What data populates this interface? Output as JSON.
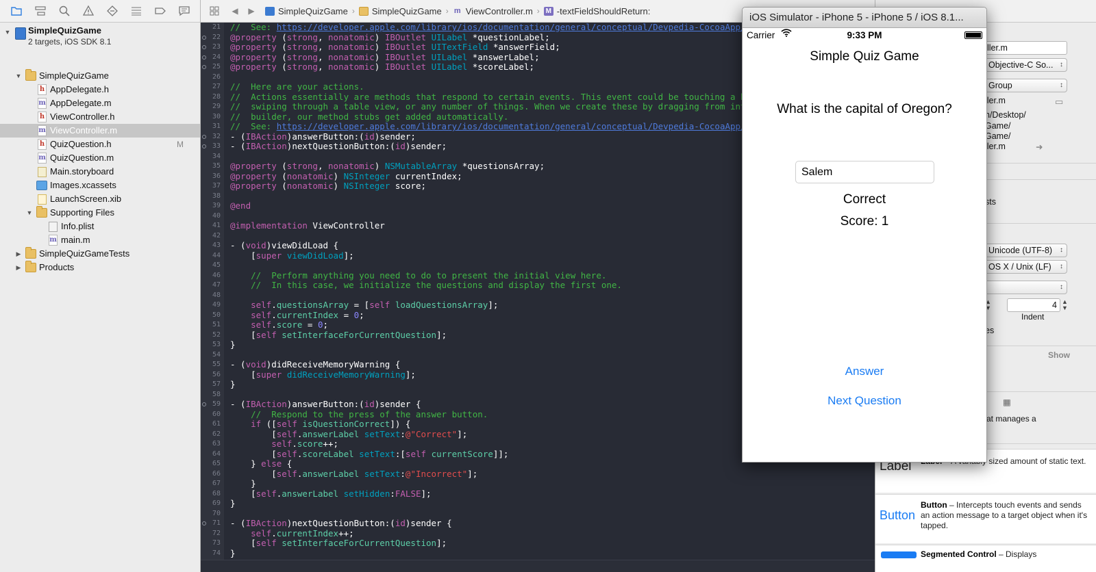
{
  "navigator": {
    "toolbar_icons": [
      "folder-icon",
      "hierarchy-icon",
      "search-icon",
      "warning-icon",
      "test-icon",
      "debug-icon",
      "breakpoint-icon",
      "log-icon"
    ],
    "project_name": "SimpleQuizGame",
    "project_subtitle": "2 targets, iOS SDK 8.1",
    "items": [
      {
        "label": "SimpleQuizGame",
        "kind": "folder",
        "badge": ""
      },
      {
        "label": "AppDelegate.h",
        "kind": "h",
        "badge": ""
      },
      {
        "label": "AppDelegate.m",
        "kind": "m",
        "badge": ""
      },
      {
        "label": "ViewController.h",
        "kind": "h",
        "badge": ""
      },
      {
        "label": "ViewController.m",
        "kind": "m",
        "badge": ""
      },
      {
        "label": "QuizQuestion.h",
        "kind": "h",
        "badge": "M"
      },
      {
        "label": "QuizQuestion.m",
        "kind": "m",
        "badge": ""
      },
      {
        "label": "Main.storyboard",
        "kind": "storyboard",
        "badge": ""
      },
      {
        "label": "Images.xcassets",
        "kind": "xcassets",
        "badge": ""
      },
      {
        "label": "LaunchScreen.xib",
        "kind": "xib",
        "badge": ""
      },
      {
        "label": "Supporting Files",
        "kind": "folder",
        "badge": ""
      },
      {
        "label": "Info.plist",
        "kind": "plist",
        "badge": ""
      },
      {
        "label": "main.m",
        "kind": "m",
        "badge": ""
      },
      {
        "label": "SimpleQuizGameTests",
        "kind": "folder",
        "badge": ""
      },
      {
        "label": "Products",
        "kind": "folder",
        "badge": ""
      }
    ]
  },
  "jumpbar": {
    "crumbs": [
      "SimpleQuizGame",
      "SimpleQuizGame",
      "ViewController.m",
      "-textFieldShouldReturn:"
    ],
    "method_badge": "M",
    "file_badge": "m"
  },
  "editor": {
    "line_numbers": [
      "21",
      "22",
      "23",
      "24",
      "25",
      "26",
      "27",
      "28",
      "29",
      "30",
      "31",
      "32",
      "33",
      "34",
      "35",
      "36",
      "37",
      "38",
      "39",
      "40",
      "41",
      "42",
      "43",
      "44",
      "45",
      "46",
      "47",
      "48",
      "49",
      "50",
      "51",
      "52",
      "53",
      "54",
      "55",
      "56",
      "57",
      "58",
      "59",
      "60",
      "61",
      "62",
      "63",
      "64",
      "65",
      "66",
      "67",
      "68",
      "69",
      "70",
      "71",
      "72",
      "73",
      "74"
    ],
    "lines": [
      [
        [
          "com",
          "//  See: "
        ],
        [
          "url",
          "https://developer.apple.com/library/ios/documentation/general/conceptual/Devpedia-CocoaApp/"
        ]
      ],
      [
        [
          "kw",
          "@property"
        ],
        [
          "pl",
          " ("
        ],
        [
          "kw",
          "strong"
        ],
        [
          "pl",
          ", "
        ],
        [
          "kw",
          "nonatomic"
        ],
        [
          "pl",
          ") "
        ],
        [
          "kw",
          "IBOutlet"
        ],
        [
          "pl",
          " "
        ],
        [
          "ty",
          "UILabel"
        ],
        [
          "pl",
          " *questionLabel;"
        ]
      ],
      [
        [
          "kw",
          "@property"
        ],
        [
          "pl",
          " ("
        ],
        [
          "kw",
          "strong"
        ],
        [
          "pl",
          ", "
        ],
        [
          "kw",
          "nonatomic"
        ],
        [
          "pl",
          ") "
        ],
        [
          "kw",
          "IBOutlet"
        ],
        [
          "pl",
          " "
        ],
        [
          "ty",
          "UITextField"
        ],
        [
          "pl",
          " *answerField;"
        ]
      ],
      [
        [
          "kw",
          "@property"
        ],
        [
          "pl",
          " ("
        ],
        [
          "kw",
          "strong"
        ],
        [
          "pl",
          ", "
        ],
        [
          "kw",
          "nonatomic"
        ],
        [
          "pl",
          ") "
        ],
        [
          "kw",
          "IBOutlet"
        ],
        [
          "pl",
          " "
        ],
        [
          "ty",
          "UILabel"
        ],
        [
          "pl",
          " *answerLabel;"
        ]
      ],
      [
        [
          "kw",
          "@property"
        ],
        [
          "pl",
          " ("
        ],
        [
          "kw",
          "strong"
        ],
        [
          "pl",
          ", "
        ],
        [
          "kw",
          "nonatomic"
        ],
        [
          "pl",
          ") "
        ],
        [
          "kw",
          "IBOutlet"
        ],
        [
          "pl",
          " "
        ],
        [
          "ty",
          "UILabel"
        ],
        [
          "pl",
          " *scoreLabel;"
        ]
      ],
      [],
      [
        [
          "com",
          "//  Here are your actions."
        ]
      ],
      [
        [
          "com",
          "//  Actions essentially are methods that respond to certain events. This event could be touching a bu"
        ]
      ],
      [
        [
          "com",
          "//  swiping through a table view, or any number of things. When we create these by dragging from inte"
        ]
      ],
      [
        [
          "com",
          "//  builder, our method stubs get added automatically."
        ]
      ],
      [
        [
          "com",
          "//  See: "
        ],
        [
          "url",
          "https://developer.apple.com/library/ios/documentation/general/conceptual/Devpedia-CocoaApp/"
        ]
      ],
      [
        [
          "pl",
          "- ("
        ],
        [
          "kw",
          "IBAction"
        ],
        [
          "pl",
          ")answerButton:("
        ],
        [
          "kw",
          "id"
        ],
        [
          "pl",
          ")sender;"
        ]
      ],
      [
        [
          "pl",
          "- ("
        ],
        [
          "kw",
          "IBAction"
        ],
        [
          "pl",
          ")nextQuestionButton:("
        ],
        [
          "kw",
          "id"
        ],
        [
          "pl",
          ")sender;"
        ]
      ],
      [],
      [
        [
          "kw",
          "@property"
        ],
        [
          "pl",
          " ("
        ],
        [
          "kw",
          "strong"
        ],
        [
          "pl",
          ", "
        ],
        [
          "kw",
          "nonatomic"
        ],
        [
          "pl",
          ") "
        ],
        [
          "ty",
          "NSMutableArray"
        ],
        [
          "pl",
          " *questionsArray;"
        ]
      ],
      [
        [
          "kw",
          "@property"
        ],
        [
          "pl",
          " ("
        ],
        [
          "kw",
          "nonatomic"
        ],
        [
          "pl",
          ") "
        ],
        [
          "ty",
          "NSInteger"
        ],
        [
          "pl",
          " currentIndex;"
        ]
      ],
      [
        [
          "kw",
          "@property"
        ],
        [
          "pl",
          " ("
        ],
        [
          "kw",
          "nonatomic"
        ],
        [
          "pl",
          ") "
        ],
        [
          "ty",
          "NSInteger"
        ],
        [
          "pl",
          " score;"
        ]
      ],
      [],
      [
        [
          "kw",
          "@end"
        ]
      ],
      [],
      [
        [
          "kw",
          "@implementation"
        ],
        [
          "pl",
          " ViewController"
        ]
      ],
      [],
      [
        [
          "pl",
          "- ("
        ],
        [
          "kw",
          "void"
        ],
        [
          "pl",
          ")viewDidLoad {"
        ]
      ],
      [
        [
          "pl",
          "    ["
        ],
        [
          "kw",
          "super"
        ],
        [
          "pl",
          " "
        ],
        [
          "fc",
          "viewDidLoad"
        ],
        [
          "pl",
          "];"
        ]
      ],
      [],
      [
        [
          "com",
          "    //  Perform anything you need to do to present the initial view here."
        ]
      ],
      [
        [
          "com",
          "    //  In this case, we initialize the questions and display the first one."
        ]
      ],
      [],
      [
        [
          "pl",
          "    "
        ],
        [
          "sl",
          "self"
        ],
        [
          "pl",
          "."
        ],
        [
          "pr",
          "questionsArray"
        ],
        [
          "pl",
          " = ["
        ],
        [
          "sl",
          "self"
        ],
        [
          "pl",
          " "
        ],
        [
          "me",
          "loadQuestionsArray"
        ],
        [
          "pl",
          "];"
        ]
      ],
      [
        [
          "pl",
          "    "
        ],
        [
          "sl",
          "self"
        ],
        [
          "pl",
          "."
        ],
        [
          "pr",
          "currentIndex"
        ],
        [
          "pl",
          " = "
        ],
        [
          "num",
          "0"
        ],
        [
          "pl",
          ";"
        ]
      ],
      [
        [
          "pl",
          "    "
        ],
        [
          "sl",
          "self"
        ],
        [
          "pl",
          "."
        ],
        [
          "pr",
          "score"
        ],
        [
          "pl",
          " = "
        ],
        [
          "num",
          "0"
        ],
        [
          "pl",
          ";"
        ]
      ],
      [
        [
          "pl",
          "    ["
        ],
        [
          "sl",
          "self"
        ],
        [
          "pl",
          " "
        ],
        [
          "me",
          "setInterfaceForCurrentQuestion"
        ],
        [
          "pl",
          "];"
        ]
      ],
      [
        [
          "pl",
          "}"
        ]
      ],
      [],
      [
        [
          "pl",
          "- ("
        ],
        [
          "kw",
          "void"
        ],
        [
          "pl",
          ")didReceiveMemoryWarning {"
        ]
      ],
      [
        [
          "pl",
          "    ["
        ],
        [
          "kw",
          "super"
        ],
        [
          "pl",
          " "
        ],
        [
          "fc",
          "didReceiveMemoryWarning"
        ],
        [
          "pl",
          "];"
        ]
      ],
      [
        [
          "pl",
          "}"
        ]
      ],
      [],
      [
        [
          "pl",
          "- ("
        ],
        [
          "kw",
          "IBAction"
        ],
        [
          "pl",
          ")answerButton:("
        ],
        [
          "kw",
          "id"
        ],
        [
          "pl",
          ")sender {"
        ]
      ],
      [
        [
          "com",
          "    //  Respond to the press of the answer button."
        ]
      ],
      [
        [
          "pl",
          "    "
        ],
        [
          "kw",
          "if"
        ],
        [
          "pl",
          " (["
        ],
        [
          "sl",
          "self"
        ],
        [
          "pl",
          " "
        ],
        [
          "me",
          "isQuestionCorrect"
        ],
        [
          "pl",
          "]) {"
        ]
      ],
      [
        [
          "pl",
          "        ["
        ],
        [
          "sl",
          "self"
        ],
        [
          "pl",
          "."
        ],
        [
          "pr",
          "answerLabel"
        ],
        [
          "pl",
          " "
        ],
        [
          "fc",
          "setText"
        ],
        [
          "pl",
          ":"
        ],
        [
          "str",
          "@\"Correct\""
        ],
        [
          "pl",
          "];"
        ]
      ],
      [
        [
          "pl",
          "        "
        ],
        [
          "sl",
          "self"
        ],
        [
          "pl",
          "."
        ],
        [
          "pr",
          "score"
        ],
        [
          "pl",
          "++;"
        ]
      ],
      [
        [
          "pl",
          "        ["
        ],
        [
          "sl",
          "self"
        ],
        [
          "pl",
          "."
        ],
        [
          "pr",
          "scoreLabel"
        ],
        [
          "pl",
          " "
        ],
        [
          "fc",
          "setText"
        ],
        [
          "pl",
          ":["
        ],
        [
          "sl",
          "self"
        ],
        [
          "pl",
          " "
        ],
        [
          "me",
          "currentScore"
        ],
        [
          "pl",
          "]];"
        ]
      ],
      [
        [
          "pl",
          "    } "
        ],
        [
          "kw",
          "else"
        ],
        [
          "pl",
          " {"
        ]
      ],
      [
        [
          "pl",
          "        ["
        ],
        [
          "sl",
          "self"
        ],
        [
          "pl",
          "."
        ],
        [
          "pr",
          "answerLabel"
        ],
        [
          "pl",
          " "
        ],
        [
          "fc",
          "setText"
        ],
        [
          "pl",
          ":"
        ],
        [
          "str",
          "@\"Incorrect\""
        ],
        [
          "pl",
          "];"
        ]
      ],
      [
        [
          "pl",
          "    }"
        ]
      ],
      [
        [
          "pl",
          "    ["
        ],
        [
          "sl",
          "self"
        ],
        [
          "pl",
          "."
        ],
        [
          "pr",
          "answerLabel"
        ],
        [
          "pl",
          " "
        ],
        [
          "fc",
          "setHidden"
        ],
        [
          "pl",
          ":"
        ],
        [
          "kw",
          "FALSE"
        ],
        [
          "pl",
          "];"
        ]
      ],
      [
        [
          "pl",
          "}"
        ]
      ],
      [],
      [
        [
          "pl",
          "- ("
        ],
        [
          "kw",
          "IBAction"
        ],
        [
          "pl",
          ")nextQuestionButton:("
        ],
        [
          "kw",
          "id"
        ],
        [
          "pl",
          ")sender {"
        ]
      ],
      [
        [
          "pl",
          "    "
        ],
        [
          "sl",
          "self"
        ],
        [
          "pl",
          "."
        ],
        [
          "pr",
          "currentIndex"
        ],
        [
          "pl",
          "++;"
        ]
      ],
      [
        [
          "pl",
          "    ["
        ],
        [
          "sl",
          "self"
        ],
        [
          "pl",
          " "
        ],
        [
          "me",
          "setInterfaceForCurrentQuestion"
        ],
        [
          "pl",
          "];"
        ]
      ],
      [
        [
          "pl",
          "}"
        ]
      ]
    ],
    "ib_connection_lines": [
      "22",
      "23",
      "24",
      "25",
      "32",
      "33",
      "59",
      "71"
    ]
  },
  "utilities": {
    "file_name_field": "ller.m",
    "file_type_popup": "Objective-C So...",
    "location_popup": "Group",
    "path_lines": [
      "ller.m",
      "n/Desktop/",
      "Game/",
      "Game/",
      "ller.m"
    ],
    "targets_label": "sts",
    "encoding_popup": "Unicode (UTF-8)",
    "line_endings_popup": "OS X / Unix (LF)",
    "indent_value": "4",
    "indent_label": "Indent",
    "wrap_label": "es",
    "show_label": "Show",
    "manages_text": "at manages a",
    "library": [
      {
        "icon_text": "Label",
        "title": "Label",
        "desc": " – A variably sized amount of static text."
      },
      {
        "icon_text": "Button",
        "title": "Button",
        "desc": " – Intercepts touch events and sends an action message to a target object when it's tapped."
      },
      {
        "icon_text": "",
        "title": "Segmented Control",
        "desc": " – Displays"
      }
    ]
  },
  "simulator": {
    "window_title": "iOS Simulator - iPhone 5 - iPhone 5 / iOS 8.1...",
    "carrier": "Carrier",
    "time": "9:33 PM",
    "app_title": "Simple Quiz Game",
    "question": "What is the capital of Oregon?",
    "answer_value": "Salem",
    "answer_label": "Correct",
    "score_label": "Score: 1",
    "answer_button": "Answer",
    "next_button": "Next Question",
    "tint_color": "#1a7cf3"
  }
}
